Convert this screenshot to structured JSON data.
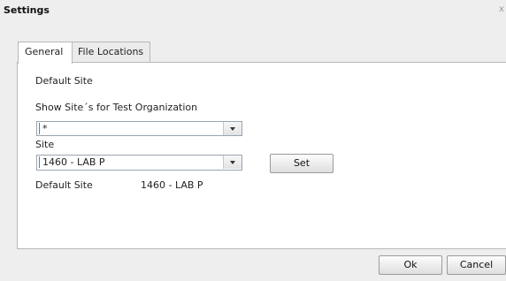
{
  "window": {
    "title": "Settings",
    "close_glyph": "x"
  },
  "tabs": [
    {
      "label": "General",
      "active": true
    },
    {
      "label": "File Locations",
      "active": false
    }
  ],
  "general": {
    "default_site_heading": "Default Site",
    "show_sites_label": "Show Site´s for Test Organization",
    "organization_select": {
      "value": "*"
    },
    "site_label": "Site",
    "site_select": {
      "value": "1460 - LAB P"
    },
    "set_button": "Set",
    "default_site_label": "Default Site",
    "default_site_value": "1460 - LAB P"
  },
  "footer": {
    "ok_label": "Ok",
    "cancel_label": "Cancel"
  }
}
